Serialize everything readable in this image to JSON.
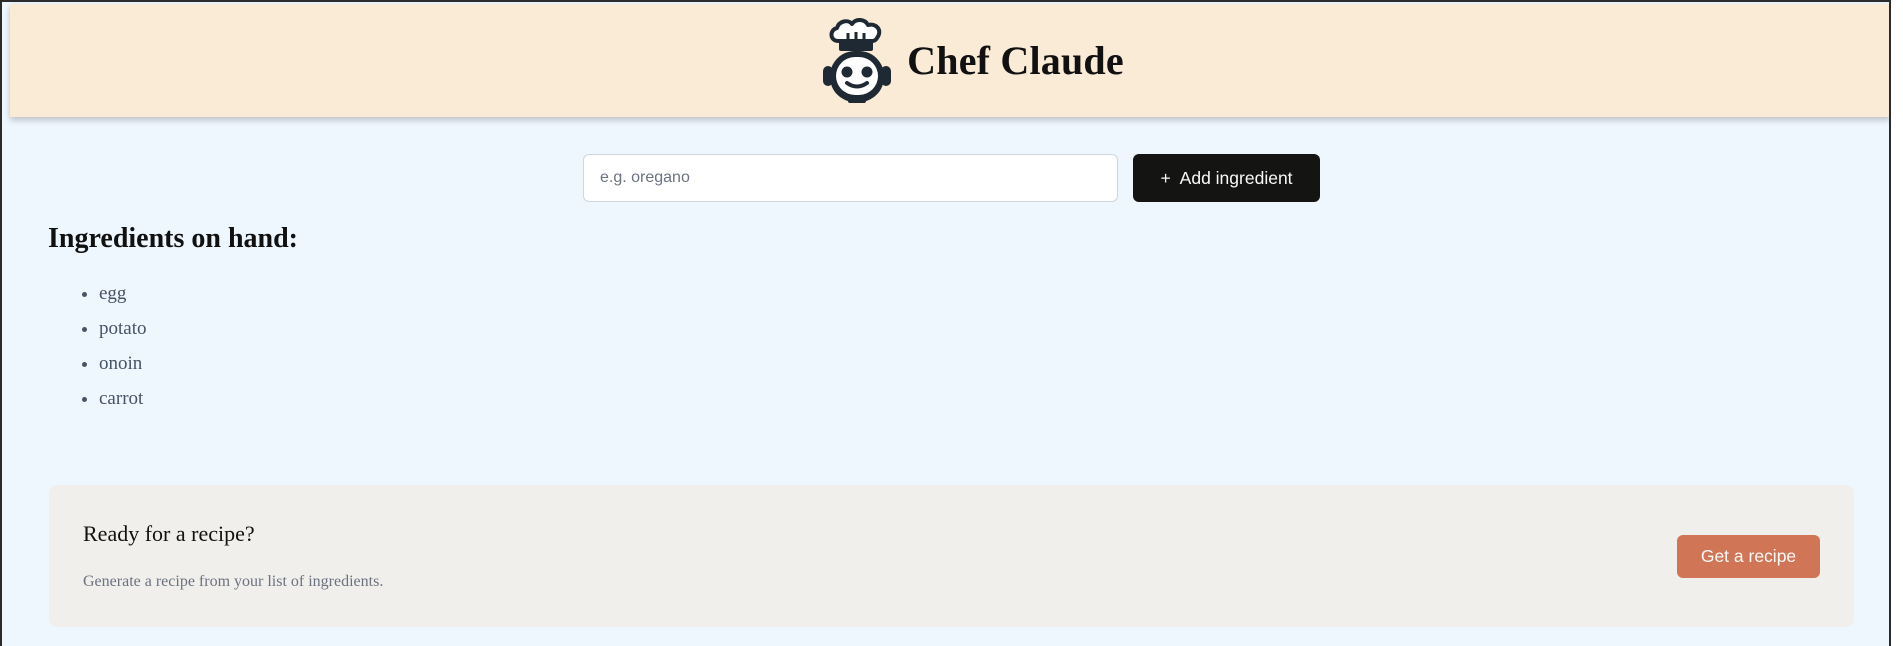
{
  "header": {
    "title": "Chef Claude",
    "logo_icon": "chef-hat-robot-icon"
  },
  "form": {
    "input_placeholder": "e.g. oregano",
    "input_value": "",
    "add_button_icon": "+",
    "add_button_label": "Add ingredient"
  },
  "ingredients": {
    "heading": "Ingredients on hand:",
    "items": [
      "egg",
      "potato",
      "onoin",
      "carrot"
    ]
  },
  "recipe_prompt": {
    "title": "Ready for a recipe?",
    "description": "Generate a recipe from your list of ingredients.",
    "button_label": "Get a recipe"
  },
  "colors": {
    "page_background": "#eef6fe",
    "header_background": "#faebd7",
    "dark_button": "#141413",
    "accent_button": "#d17557",
    "card_background": "#f0efeb"
  }
}
